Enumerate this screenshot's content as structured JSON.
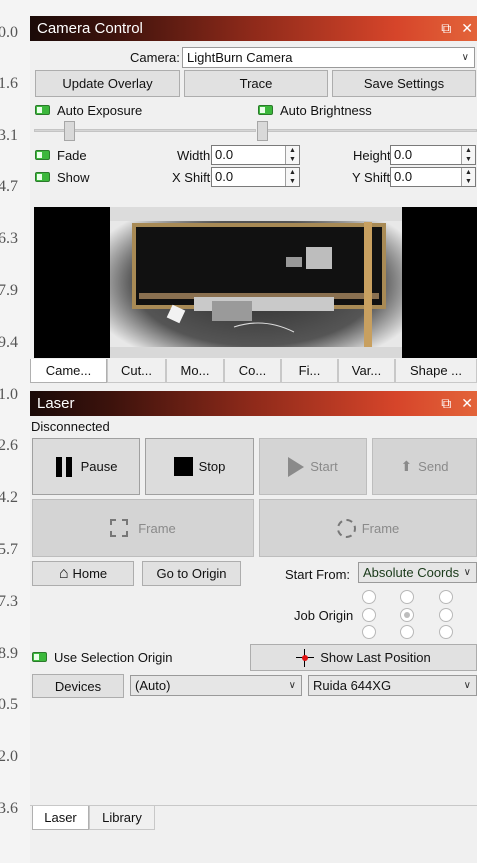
{
  "ruler": {
    "labels": [
      "0.0",
      "1.6",
      "3.1",
      "4.7",
      "6.3",
      "7.9",
      "9.4",
      "1.0",
      "2.6",
      "4.2",
      "5.7",
      "7.3",
      "8.9",
      "0.5",
      "2.0",
      "3.6"
    ]
  },
  "camera_panel": {
    "title": "Camera Control",
    "camera_label": "Camera:",
    "camera_value": "LightBurn Camera",
    "update_overlay_label": "Update Overlay",
    "trace_label": "Trace",
    "save_settings_label": "Save Settings",
    "auto_exposure_label": "Auto Exposure",
    "auto_brightness_label": "Auto Brightness",
    "fade_label": "Fade",
    "show_label": "Show",
    "width_label": "Width",
    "width_value": "0.0",
    "height_label": "Height",
    "height_value": "0.0",
    "xshift_label": "X Shift",
    "xshift_value": "0.0",
    "yshift_label": "Y Shift",
    "yshift_value": "0.0",
    "tabs": [
      "Came...",
      "Cut...",
      "Mo...",
      "Co...",
      "Fi...",
      "Var...",
      "Shape ..."
    ]
  },
  "laser_panel": {
    "title": "Laser",
    "status": "Disconnected",
    "pause_label": "Pause",
    "stop_label": "Stop",
    "start_label": "Start",
    "send_label": "Send",
    "frame_label": "Frame",
    "frame2_label": "Frame",
    "home_label": "Home",
    "go_to_origin_label": "Go to Origin",
    "start_from_label": "Start From:",
    "start_from_value": "Absolute Coords",
    "job_origin_label": "Job Origin",
    "use_selection_origin_label": "Use Selection Origin",
    "show_last_position_label": "Show Last Position",
    "devices_label": "Devices",
    "port_value": "(Auto)",
    "device_value": "Ruida 644XG",
    "bottom_tabs": [
      "Laser",
      "Library"
    ]
  },
  "colors": {
    "toggle_on": "#3cb83c",
    "title_dark": "#1a0a08",
    "title_accent": "#e3643a"
  }
}
